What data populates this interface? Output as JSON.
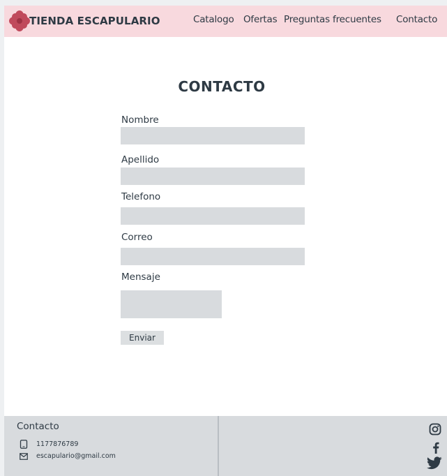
{
  "brand": {
    "name": "TIENDA ESCAPULARIO",
    "logo_icon": "flower-icon",
    "logo_color": "#c04a5c"
  },
  "nav": {
    "catalogo": "Catalogo",
    "ofertas": "Ofertas",
    "preguntas": "Preguntas frecuentes",
    "contacto": "Contacto"
  },
  "form": {
    "title": "CONTACTO",
    "nombre_label": "Nombre",
    "apellido_label": "Apellido",
    "telefono_label": "Telefono",
    "correo_label": "Correo",
    "mensaje_label": "Mensaje",
    "nombre_value": "",
    "apellido_value": "",
    "telefono_value": "",
    "correo_value": "",
    "mensaje_value": "",
    "submit_label": "Enviar"
  },
  "footer": {
    "title": "Contacto",
    "phone": "1177876789",
    "email": "escapulario@gmail.com",
    "phone_icon": "phone-icon",
    "email_icon": "mail-icon",
    "social_icons": [
      "instagram-icon",
      "facebook-icon",
      "twitter-icon"
    ]
  },
  "colors": {
    "navbar_bg": "#f8d9de",
    "footer_bg": "#d8dbde",
    "field_bg": "#d8dbde",
    "text": "#2e3a44"
  }
}
